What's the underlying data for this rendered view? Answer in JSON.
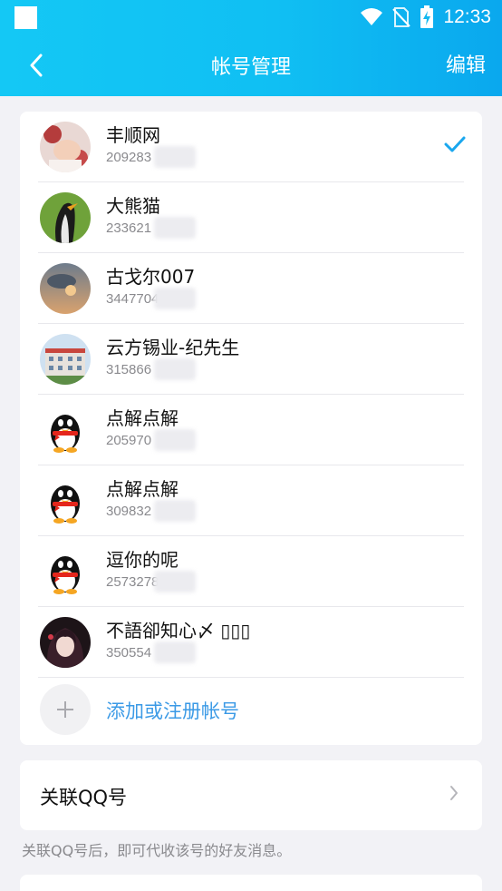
{
  "status_bar": {
    "time": "12:33"
  },
  "header": {
    "title": "帐号管理",
    "edit_label": "编辑"
  },
  "accounts": [
    {
      "name": "丰顺网",
      "number": "209283",
      "avatar": "baby-photo-avatar",
      "selected": true
    },
    {
      "name": "大熊猫",
      "number": "233621",
      "avatar": "penguin-photo-avatar",
      "selected": false
    },
    {
      "name": "古戈尔007",
      "number": "3447704",
      "avatar": "sunset-sky-avatar",
      "selected": false
    },
    {
      "name": "云方锡业-纪先生",
      "number": "315866",
      "avatar": "building-photo-avatar",
      "selected": false
    },
    {
      "name": "点解点解",
      "number": "205970",
      "avatar": "qq-penguin-avatar",
      "selected": false
    },
    {
      "name": "点解点解",
      "number": "309832",
      "avatar": "qq-penguin-avatar",
      "selected": false
    },
    {
      "name": "逗你的呢",
      "number": "2573278",
      "avatar": "qq-penguin-avatar",
      "selected": false
    },
    {
      "name": "不語卻知心〆 ▯▯▯",
      "number": "350554",
      "avatar": "anime-girl-avatar",
      "selected": false
    }
  ],
  "add_account": {
    "label": "添加或注册帐号"
  },
  "link_qq": {
    "label": "关联QQ号",
    "hint": "关联QQ号后，即可代收该号的好友消息。"
  },
  "colors": {
    "header_blue": "#10bff3",
    "accent_blue": "#3b9ae6",
    "background": "#f2f2f6"
  }
}
